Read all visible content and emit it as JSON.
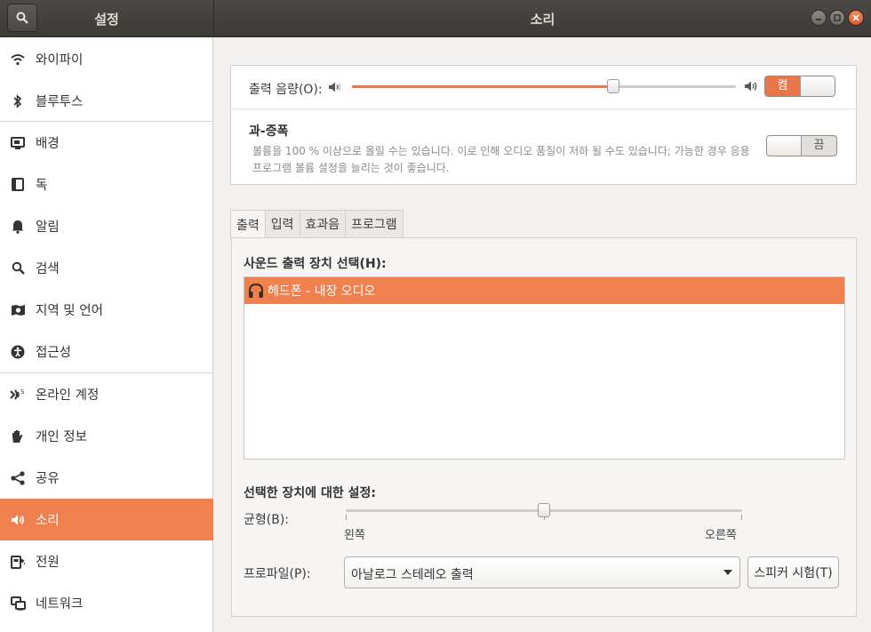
{
  "window": {
    "sidebar_title": "설정",
    "panel_title": "소리",
    "controls": [
      "minimize",
      "maximize",
      "close"
    ]
  },
  "sidebar": {
    "items": [
      {
        "label": "와이파이",
        "icon": "wifi-icon"
      },
      {
        "label": "블루투스",
        "icon": "bluetooth-icon"
      },
      {
        "label": "배경",
        "icon": "background-icon"
      },
      {
        "label": "독",
        "icon": "dock-icon"
      },
      {
        "label": "알림",
        "icon": "bell-icon"
      },
      {
        "label": "검색",
        "icon": "search-icon"
      },
      {
        "label": "지역 및 언어",
        "icon": "region-icon"
      },
      {
        "label": "접근성",
        "icon": "accessibility-icon"
      },
      {
        "label": "온라인 계정",
        "icon": "online-accounts-icon"
      },
      {
        "label": "개인 정보",
        "icon": "privacy-hand-icon"
      },
      {
        "label": "공유",
        "icon": "share-icon"
      },
      {
        "label": "소리",
        "icon": "speaker-icon",
        "active": true
      },
      {
        "label": "전원",
        "icon": "power-icon"
      },
      {
        "label": "네트워크",
        "icon": "network-icon"
      }
    ]
  },
  "volume": {
    "label": "출력 음량(O):",
    "level_percent": 68,
    "switch_label": "켬",
    "switch_on": true
  },
  "amplify": {
    "title": "과-증폭",
    "description": "볼륨을 100 % 이상으로 올릴 수는 있습니다. 이로 인해 오디오 품질이 저하 될 수도 있습니다; 가능한 경우 응용 프로그램 볼륨 설정을 늘리는 것이 좋습니다.",
    "switch_label": "끔",
    "switch_on": false
  },
  "tabs": [
    "출력",
    "입력",
    "효과음",
    "프로그램"
  ],
  "output": {
    "device_heading": "사운드 출력 장치 선택(H):",
    "devices": [
      "헤드폰 - 내장 오디오"
    ],
    "settings_heading": "선택한 장치에 대한 설정:",
    "balance_label": "균형(B):",
    "balance_left": "왼쪽",
    "balance_right": "오른쪽",
    "balance_value": 0.5,
    "profile_label": "프로파일(P):",
    "profile_value": "아날로그 스테레오 출력",
    "test_button": "스피커 시험(T)"
  },
  "colors": {
    "accent": "#f1804f",
    "header": "#3b3a37"
  }
}
